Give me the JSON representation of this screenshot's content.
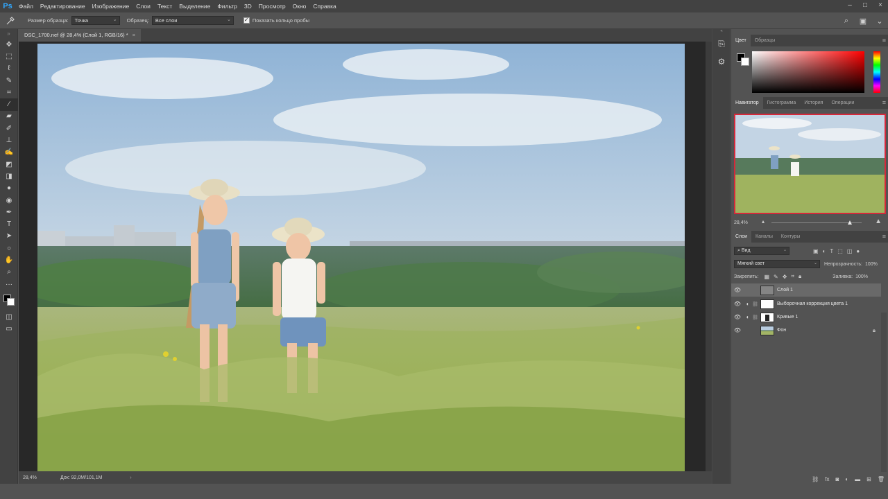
{
  "app": {
    "logo": "Ps"
  },
  "menu": [
    "Файл",
    "Редактирование",
    "Изображение",
    "Слои",
    "Текст",
    "Выделение",
    "Фильтр",
    "3D",
    "Просмотр",
    "Окно",
    "Справка"
  ],
  "window_controls": [
    "–",
    "□",
    "×"
  ],
  "options": {
    "sample_size_label": "Размер образца:",
    "sample_size_value": "Точка",
    "sample_label": "Образец:",
    "sample_value": "Все слои",
    "show_ring_label": "Показать кольцо пробы",
    "show_ring_checked": true
  },
  "document": {
    "tab_title": "DSC_1700.nef @ 28,4% (Слой 1, RGB/16) *",
    "close": "×",
    "zoom": "28,4%",
    "doc_info": "Док: 92,0M/101,1M",
    "status_arrow": "›"
  },
  "tools": [
    "move-tool",
    "marquee-tool",
    "lasso-tool",
    "quick-select-tool",
    "crop-tool",
    "eyedropper-tool",
    "healing-tool",
    "brush-tool",
    "stamp-tool",
    "history-brush-tool",
    "eraser-tool",
    "gradient-tool",
    "blur-tool",
    "dodge-tool",
    "pen-tool",
    "type-tool",
    "path-select-tool",
    "ellipse-tool",
    "hand-tool",
    "zoom-tool",
    "more-tools"
  ],
  "active_tool": "eyedropper-tool",
  "color_panel": {
    "tabs": [
      "Цвет",
      "Образцы"
    ],
    "active": 0,
    "fg": "#000000",
    "bg": "#ffffff"
  },
  "navigator_panel": {
    "tabs": [
      "Навигатор",
      "Гистограмма",
      "История",
      "Операции"
    ],
    "active": 0,
    "zoom": "28,4%",
    "view_box_color": "#d6283a"
  },
  "layers_panel": {
    "tabs": [
      "Слои",
      "Каналы",
      "Контуры"
    ],
    "active": 0,
    "filter": "Вид",
    "blend_mode": "Мягкий свет",
    "opacity_label": "Непрозрачность:",
    "opacity_value": "100%",
    "lock_label": "Закрепить:",
    "fill_label": "Заливка:",
    "fill_value": "100%",
    "layers": [
      {
        "name": "Слой 1",
        "selected": true,
        "adjustment": false,
        "locked": false
      },
      {
        "name": "Выборочная коррекция цвета 1",
        "selected": false,
        "adjustment": true,
        "locked": false
      },
      {
        "name": "Кривые 1",
        "selected": false,
        "adjustment": true,
        "locked": false
      },
      {
        "name": "Фон",
        "selected": false,
        "adjustment": false,
        "locked": true
      }
    ]
  }
}
